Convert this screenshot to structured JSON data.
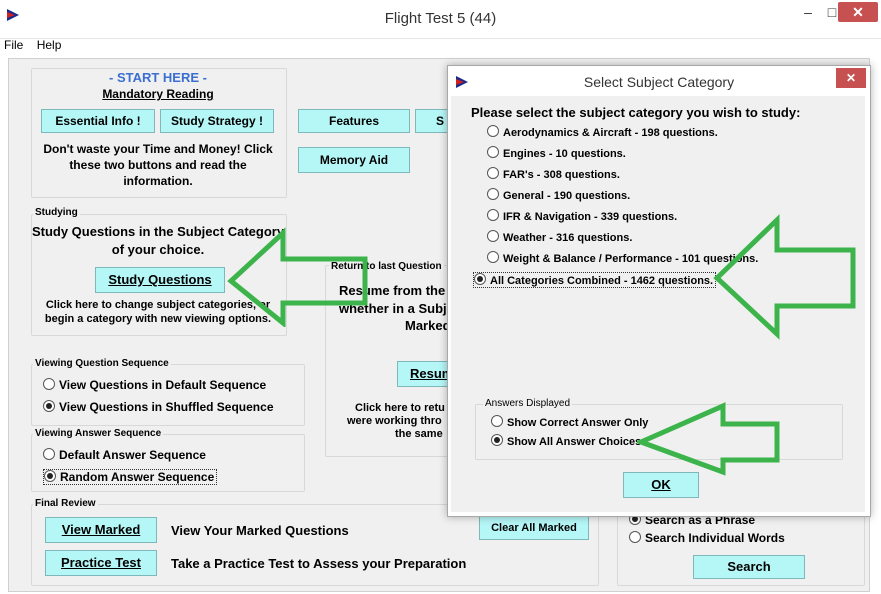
{
  "window": {
    "title": "Flight Test 5 (44)",
    "minimize": "–",
    "maximize": "□",
    "close": "✕"
  },
  "menu": [
    "File",
    "Help"
  ],
  "start": {
    "heading": "- START HERE -",
    "subheading": "Mandatory Reading",
    "essential_btn": "Essential Info !",
    "strategy_btn": "Study Strategy !",
    "note": "Don't waste your Time and Money! Click these two buttons and read the information."
  },
  "features_btn": "Features",
  "s_btn": "S",
  "memory_btn": "Memory Aid",
  "studying": {
    "label": "Studying",
    "text": "Study Questions in the Subject Category of your choice.",
    "btn": "Study Questions",
    "note": "Click here to change subject categories, or begin a category with new viewing options."
  },
  "resume": {
    "label": "Return to last Question",
    "text1": "Resume from the",
    "text2": "whether in a Subje",
    "text3": "Marked",
    "btn": "Resum",
    "note1": "Click here to retu",
    "note2": "were working thro",
    "note3": "the same"
  },
  "viewing_seq": {
    "label": "Viewing Question Sequence",
    "opt1": "View Questions in Default Sequence",
    "opt2": "View Questions in Shuffled Sequence"
  },
  "answer_seq": {
    "label": "Viewing Answer Sequence",
    "opt1": "Default Answer Sequence",
    "opt2": "Random Answer Sequence"
  },
  "final": {
    "label": "Final Review",
    "view_btn": "View Marked",
    "view_text": "View Your Marked Questions",
    "clear_btn": "Clear All Marked",
    "practice_btn": "Practice Test",
    "practice_text": "Take a Practice Test to Assess your Preparation"
  },
  "search": {
    "opt1": "Search as a Phrase",
    "opt2": "Search Individual Words",
    "btn": "Search"
  },
  "dialog": {
    "title": "Select Subject Category",
    "prompt": "Please select the subject category you wish to study:",
    "categories": [
      "Aerodynamics & Aircraft - 198 questions.",
      "Engines - 10 questions.",
      "FAR's - 308 questions.",
      "General - 190 questions.",
      "IFR & Navigation - 339 questions.",
      "Weather - 316 questions.",
      "Weight & Balance / Performance - 101 questions.",
      "All Categories Combined - 1462 questions."
    ],
    "answers_label": "Answers Displayed",
    "answer_opt1": "Show Correct Answer Only",
    "answer_opt2": "Show All Answer Choices",
    "ok": "OK",
    "close": "✕"
  },
  "colors": {
    "button_bg": "#b5f7f7",
    "arrow": "#3cb44b",
    "close_red": "#c75050"
  }
}
